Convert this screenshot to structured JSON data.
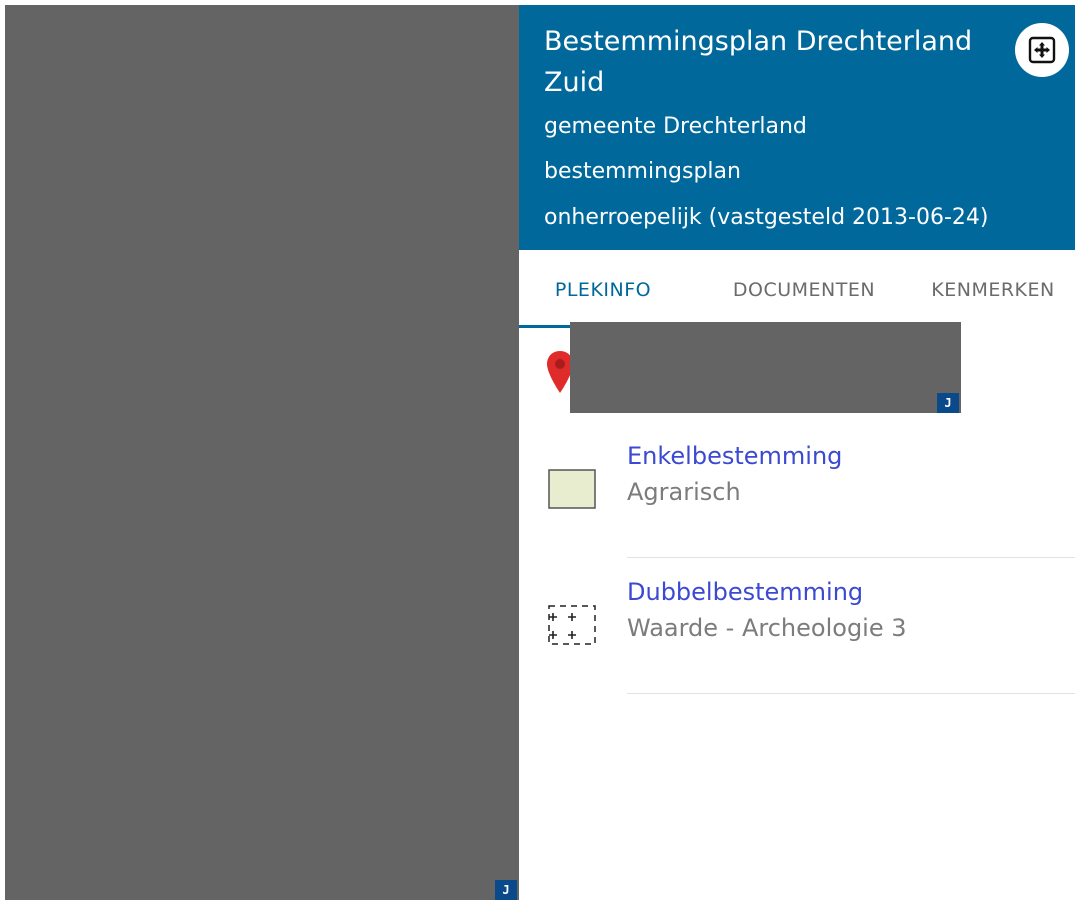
{
  "map": {
    "redaction_badge": "J"
  },
  "plan": {
    "title": "Bestemmingsplan Drechterland Zuid",
    "municipality": "gemeente Drechterland",
    "plan_type": "bestemmingsplan",
    "status": "onherroepelijk (vastgesteld 2013-06-24)"
  },
  "tabs": [
    {
      "label": "PLEKINFO",
      "active": true
    },
    {
      "label": "DOCUMENTEN",
      "active": false
    },
    {
      "label": "KENMERKEN",
      "active": false
    }
  ],
  "location": {
    "redaction_badge": "J"
  },
  "destinations": [
    {
      "category": "Enkelbestemming",
      "value": "Agrarisch",
      "swatch_color": "#e8edcf"
    },
    {
      "category": "Dubbelbestemming",
      "value": "Waarde - Archeologie 3",
      "swatch_color": "#ffffff"
    }
  ],
  "colors": {
    "header_bg": "#01689b",
    "link_text": "#3b4ad1",
    "pin": "#e02b2b",
    "redacted": "#646464"
  },
  "icons": {
    "expand": "move-arrows-icon",
    "location": "map-pin-icon"
  }
}
